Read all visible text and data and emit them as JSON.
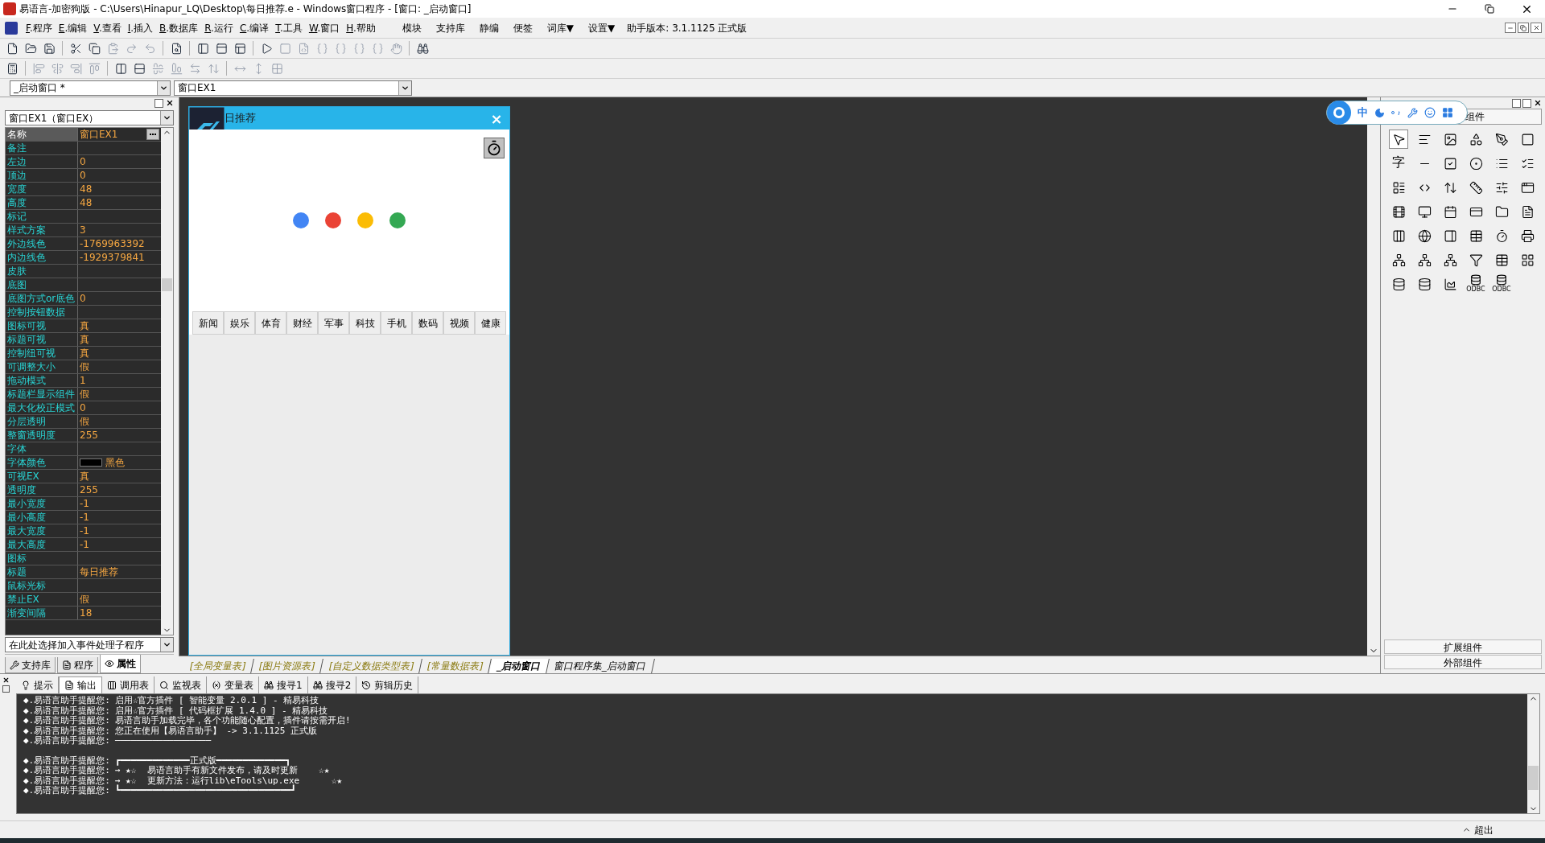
{
  "title_bar": {
    "title": "易语言-加密狗版 - C:\\Users\\Hinapur_LQ\\Desktop\\每日推荐.e - Windows窗口程序 - [窗口: _启动窗口]"
  },
  "menu_bar": {
    "items": [
      {
        "key": "F",
        "label": ".程序"
      },
      {
        "key": "E",
        "label": ".编辑"
      },
      {
        "key": "V",
        "label": ".查看"
      },
      {
        "key": "I",
        "label": ".插入"
      },
      {
        "key": "B",
        "label": ".数据库"
      },
      {
        "key": "R",
        "label": ".运行"
      },
      {
        "key": "C",
        "label": ".编译"
      },
      {
        "key": "T",
        "label": ".工具"
      },
      {
        "key": "W",
        "label": ".窗口"
      },
      {
        "key": "H",
        "label": ".帮助"
      }
    ],
    "extras": [
      "模块",
      "支持库",
      "静编",
      "便签",
      "词库▼",
      "设置▼"
    ],
    "version": "助手版本: 3.1.1125 正式版"
  },
  "selectors": {
    "window": "_启动窗口 *",
    "control": "窗口EX1"
  },
  "properties": {
    "object": "窗口EX1（窗口EX）",
    "rows": [
      {
        "name": "名称",
        "value": "窗口EX1",
        "selected": true
      },
      {
        "name": "备注",
        "selected": false
      },
      {
        "name": "左边",
        "value": "0",
        "selected": false
      },
      {
        "name": "顶边",
        "value": "0",
        "selected": false
      },
      {
        "name": "宽度",
        "value": "48",
        "selected": false
      },
      {
        "name": "高度",
        "value": "48",
        "selected": false
      },
      {
        "name": "标记",
        "selected": false
      },
      {
        "name": "样式方案",
        "value": "3",
        "selected": false
      },
      {
        "name": "外边线色",
        "value": "-1769963392",
        "selected": false
      },
      {
        "name": "内边线色",
        "value": "-1929379841",
        "selected": false
      },
      {
        "name": "皮肤",
        "selected": false
      },
      {
        "name": "底图",
        "selected": false
      },
      {
        "name": "底图方式or底色",
        "value": "0",
        "selected": false
      },
      {
        "name": "控制按钮数据",
        "selected": false
      },
      {
        "name": "图标可视",
        "value": "真",
        "selected": false
      },
      {
        "name": "标题可视",
        "value": "真",
        "selected": false
      },
      {
        "name": "控制纽可视",
        "value": "真",
        "selected": false
      },
      {
        "name": "可调整大小",
        "value": "假",
        "selected": false
      },
      {
        "name": "拖动模式",
        "value": "1",
        "selected": false
      },
      {
        "name": "标题栏显示组件",
        "value": "假",
        "selected": false
      },
      {
        "name": "最大化校正模式",
        "value": "0",
        "selected": false
      },
      {
        "name": "分层透明",
        "value": "假",
        "selected": false
      },
      {
        "name": "整窗透明度",
        "value": "255",
        "selected": false
      },
      {
        "name": "字体",
        "selected": false
      },
      {
        "name": "字体颜色",
        "value": "黑色",
        "color": "#000000",
        "selected": false
      },
      {
        "name": "可视EX",
        "value": "真",
        "selected": false
      },
      {
        "name": "透明度",
        "value": "255",
        "selected": false
      },
      {
        "name": "最小宽度",
        "value": "-1",
        "selected": false
      },
      {
        "name": "最小高度",
        "value": "-1",
        "selected": false
      },
      {
        "name": "最大宽度",
        "value": "-1",
        "selected": false
      },
      {
        "name": "最大高度",
        "value": "-1",
        "selected": false
      },
      {
        "name": "图标",
        "selected": false
      },
      {
        "name": "标题",
        "value": "每日推荐",
        "selected": false
      },
      {
        "name": "鼠标光标",
        "selected": false
      },
      {
        "name": "禁止EX",
        "value": "假",
        "selected": false
      },
      {
        "name": "渐变间隔",
        "value": "18",
        "selected": false
      }
    ],
    "event_selector": "在此处选择加入事件处理子程序"
  },
  "left_tabs": [
    {
      "label": "支持库",
      "selected": false
    },
    {
      "label": "程序",
      "selected": false
    },
    {
      "label": "属性",
      "selected": true
    }
  ],
  "form_preview": {
    "title": "日推荐",
    "close": "×",
    "loading_dots": [
      {
        "color": "#4285f4"
      },
      {
        "color": "#ea4335"
      },
      {
        "color": "#fbbc05"
      },
      {
        "color": "#34a853"
      }
    ],
    "categories": [
      "新闻",
      "娱乐",
      "体育",
      "财经",
      "军事",
      "科技",
      "手机",
      "数码",
      "视频",
      "健康"
    ]
  },
  "ime_bar": {
    "mode": "中"
  },
  "component_panel": {
    "title": "组件",
    "char_glyph": "字",
    "odbc_labels": [
      "ODBC",
      "ODBC"
    ],
    "buttons": [
      "扩展组件",
      "外部组件"
    ]
  },
  "document_tabs": [
    {
      "label": "[全局变量表]",
      "kind": "table",
      "selected": false
    },
    {
      "label": "[图片资源表]",
      "kind": "table",
      "selected": false
    },
    {
      "label": "[自定义数据类型表]",
      "kind": "table",
      "selected": false
    },
    {
      "label": "[常量数据表]",
      "kind": "table",
      "selected": false
    },
    {
      "label": "_启动窗口",
      "kind": "code",
      "selected": true
    },
    {
      "label": "窗口程序集_启动窗口",
      "kind": "code",
      "selected": false
    }
  ],
  "output_tabs": [
    {
      "label": "提示",
      "selected": false
    },
    {
      "label": "输出",
      "selected": true
    },
    {
      "label": "调用表",
      "selected": false
    },
    {
      "label": "监视表",
      "selected": false
    },
    {
      "label": "变量表",
      "selected": false
    },
    {
      "label": "搜寻1",
      "selected": false
    },
    {
      "label": "搜寻2",
      "selected": false
    },
    {
      "label": "剪辑历史",
      "selected": false
    }
  ],
  "output_blocks": [
    [
      {
        "prefix": "◆.易语言助手提醒您:",
        "text": "启用☆官方插件 [ 智能变量 2.0.1 ] - 精易科技"
      },
      {
        "prefix": "◆.易语言助手提醒您:",
        "text": "启用☆官方插件 [ 代码框扩展 1.4.0 ] - 精易科技"
      },
      {
        "prefix": "◆.易语言助手提醒您:",
        "text": "易语言助手加载完毕，各个功能随心配置，插件请按需开启!"
      },
      {
        "prefix": "◆.易语言助手提醒您:",
        "text": "您正在使用【易语言助手】 -> 3.1.1125 正式版"
      },
      {
        "prefix": "◆.易语言助手提醒您:",
        "text": "──────────────────"
      }
    ],
    [
      {
        "prefix": "◆.易语言助手提醒您:",
        "text": "┏━━━━━━━━━━━━━正式版━━━━━━━━━━━━━┓"
      },
      {
        "prefix": "◆.易语言助手提醒您:",
        "text": "→ ★☆  易语言助手有新文件发布，请及时更新    ☆★"
      },
      {
        "prefix": "◆.易语言助手提醒您:",
        "text": "→ ★☆  更新方法：运行lib\\eTools\\up.exe      ☆★"
      },
      {
        "prefix": "◆.易语言助手提醒您:",
        "text": "┗━━━━━━━━━━━━━━━━━━━━━━━━━━━━━━━━┛"
      }
    ]
  ],
  "status_bar": {
    "button": "超出"
  }
}
